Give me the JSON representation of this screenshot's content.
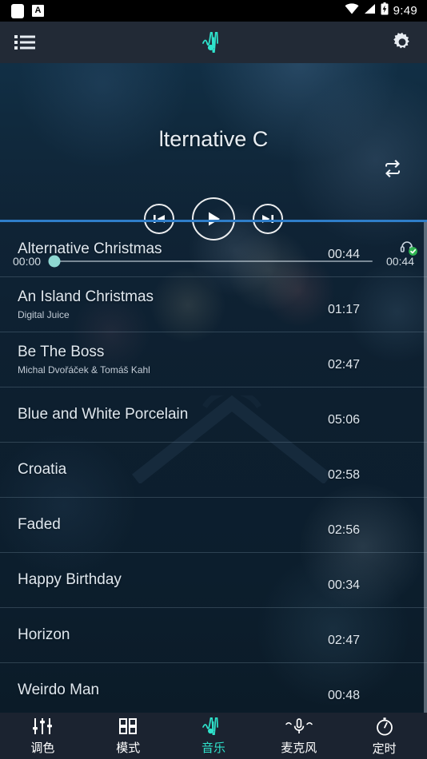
{
  "status_bar": {
    "time": "9:49",
    "left_icons": [
      "notification-icon",
      "a-badge-icon"
    ],
    "right_icons": [
      "wifi-icon",
      "signal-icon",
      "battery-charging-icon"
    ]
  },
  "app_bar": {
    "playlist_icon": "playlist-icon",
    "logo_icon": "music-wave-icon",
    "settings_icon": "gear-icon"
  },
  "player": {
    "track_title": "lternative C",
    "full_track_title": "Alternative Christmas",
    "repeat_icon": "repeat-icon",
    "prev_icon": "skip-previous-icon",
    "play_icon": "play-icon",
    "next_icon": "skip-next-icon",
    "elapsed": "00:00",
    "duration": "00:44",
    "progress_percent": 0
  },
  "song_list": [
    {
      "title": "Alternative Christmas",
      "artist": "",
      "duration": "00:44",
      "badge": "headphone-check-icon"
    },
    {
      "title": "An Island Christmas",
      "artist": "Digital Juice",
      "duration": "01:17",
      "badge": ""
    },
    {
      "title": "Be The Boss",
      "artist": "Michal Dvořáček & Tomáš Kahl",
      "duration": "02:47",
      "badge": ""
    },
    {
      "title": "Blue and White Porcelain",
      "artist": "",
      "duration": "05:06",
      "badge": ""
    },
    {
      "title": "Croatia",
      "artist": "",
      "duration": "02:58",
      "badge": ""
    },
    {
      "title": "Faded",
      "artist": "",
      "duration": "02:56",
      "badge": ""
    },
    {
      "title": "Happy Birthday",
      "artist": "",
      "duration": "00:34",
      "badge": ""
    },
    {
      "title": "Horizon",
      "artist": "",
      "duration": "02:47",
      "badge": ""
    },
    {
      "title": "Weirdo Man",
      "artist": "",
      "duration": "00:48",
      "badge": ""
    }
  ],
  "bottom_nav": {
    "active_index": 2,
    "items": [
      {
        "label": "调色",
        "icon": "equalizer-icon"
      },
      {
        "label": "模式",
        "icon": "grid-icon"
      },
      {
        "label": "音乐",
        "icon": "music-wave-icon"
      },
      {
        "label": "麦克风",
        "icon": "microphone-icon"
      },
      {
        "label": "定时",
        "icon": "timer-icon"
      }
    ]
  },
  "colors": {
    "accent_teal": "#2fe3cc",
    "slider_thumb": "#8fd8d2",
    "divider_blue": "#2f7ec9",
    "appbar_bg": "#222a36",
    "bottomnav_bg": "#1b2330",
    "badge_green": "#2fb451"
  }
}
